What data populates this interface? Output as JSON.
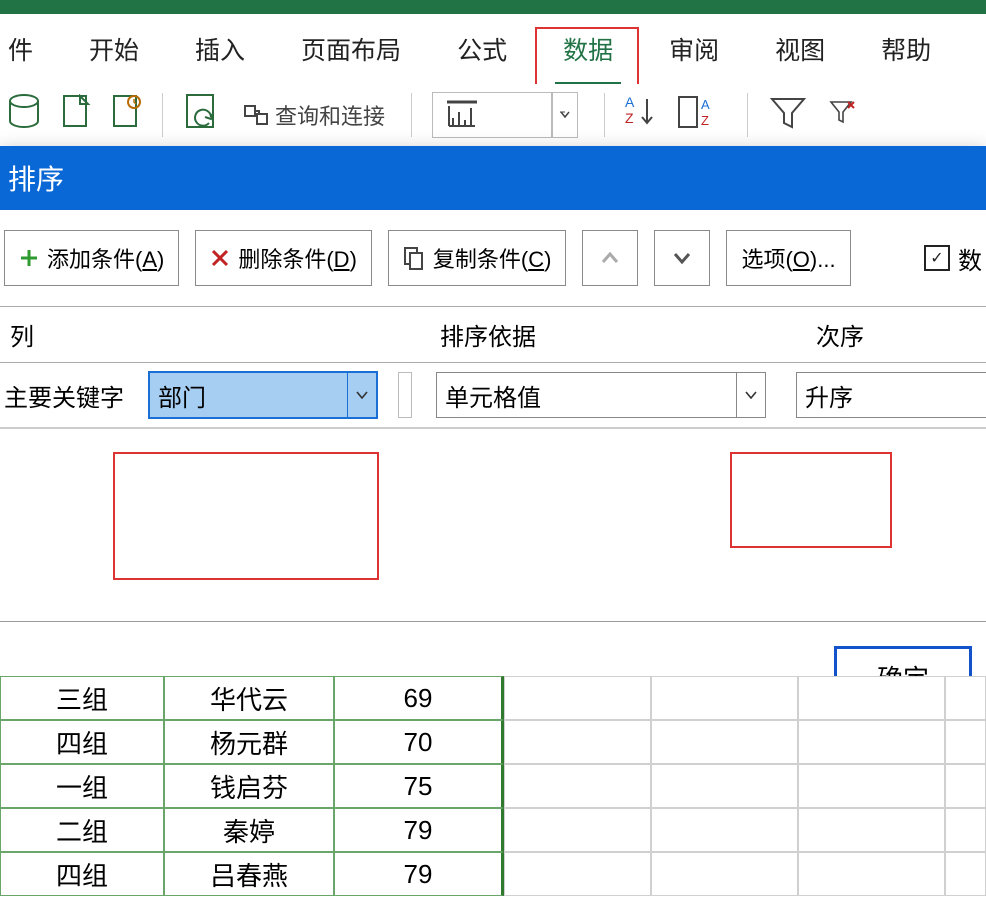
{
  "tabs": {
    "file": "件",
    "home": "开始",
    "insert": "插入",
    "layout": "页面布局",
    "formulas": "公式",
    "data": "数据",
    "review": "审阅",
    "view": "视图",
    "help": "帮助"
  },
  "ribbon": {
    "query_label": "查询和连接"
  },
  "dialog": {
    "title": "排序",
    "add": {
      "label": "添加条件(",
      "mn": "A",
      "tail": ")"
    },
    "del": {
      "label": "删除条件(",
      "mn": "D",
      "tail": ")"
    },
    "copy": {
      "label": "复制条件(",
      "mn": "C",
      "tail": ")"
    },
    "options": {
      "label": "选项(",
      "mn": "O",
      "tail": ")..."
    },
    "has_header": "数",
    "col_header": "列",
    "sort_on_header": "排序依据",
    "order_header": "次序",
    "key_label": "主要关键字",
    "key_value": "部门",
    "sort_on_value": "单元格值",
    "order_value": "升序",
    "ok": "确定"
  },
  "sheet": {
    "rows": [
      {
        "a": "三组",
        "b": "华代云",
        "c": "69"
      },
      {
        "a": "四组",
        "b": "杨元群",
        "c": "70"
      },
      {
        "a": "一组",
        "b": "钱启芬",
        "c": "75"
      },
      {
        "a": "二组",
        "b": "秦婷",
        "c": "79"
      },
      {
        "a": "四组",
        "b": "吕春燕",
        "c": "79"
      }
    ]
  }
}
